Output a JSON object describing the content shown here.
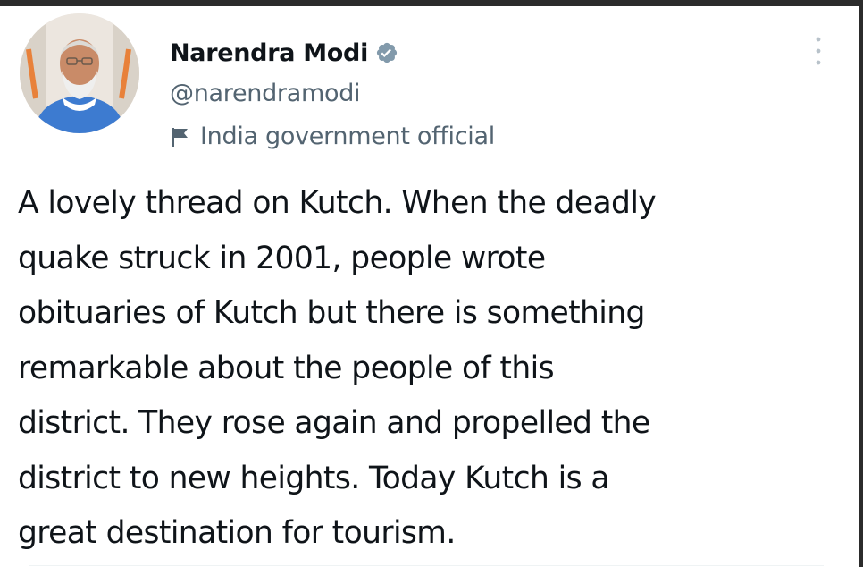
{
  "tweet": {
    "author": {
      "name": "Narendra Modi",
      "handle": "@narendramodi",
      "verified": true,
      "affiliation": "India government official"
    },
    "text_lines": [
      "A lovely thread on Kutch. When the deadly",
      "quake struck in 2001, people wrote",
      "obituaries of Kutch but there is something",
      "remarkable about the people of this",
      "district. They rose again and propelled the",
      "district to new heights. Today Kutch is a",
      "great destination for tourism."
    ]
  },
  "icons": {
    "verified": "verified-badge-icon",
    "affiliation": "flag-icon",
    "more": "more-options-icon"
  },
  "colors": {
    "text_primary": "#0f1419",
    "text_secondary": "#536471",
    "verified_badge": "#829aab",
    "divider": "#eff3f4"
  }
}
